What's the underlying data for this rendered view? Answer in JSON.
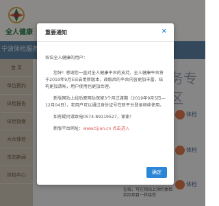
{
  "header": {
    "logo_text": "全人健康"
  },
  "nav": {
    "tab": "宁波体检服务"
  },
  "sidebar": {
    "items": [
      {
        "label": "首 页"
      },
      {
        "label": "单位预约"
      },
      {
        "label": "体检报告"
      },
      {
        "label": "体检指南"
      },
      {
        "label": "大众体检"
      },
      {
        "label": "本站新闻"
      },
      {
        "label": "体检中心"
      }
    ]
  },
  "main": {
    "banner_title": "务专区",
    "cards": [
      {
        "label": "体检"
      },
      {
        "label": "体检"
      },
      {
        "label": "体检"
      }
    ],
    "footer_line1": "在线，可在网站上预约体检",
    "footer_line2": "实际项目一样接受"
  },
  "modal": {
    "title": "重要通知",
    "close_symbol": "×",
    "greeting": "各位全人健康的用户：",
    "para1": "您好！感谢您一直对全人健康平台的支持，全人健康平台将于2019年9月5日启用新版本，改版后的平台内容更加丰富，结构更加清晰，用户使用也更加合理。",
    "para2": "新版网站上线后原网站保留3个月过渡期（2019年9月5日—12月04日），老用户可以通过身份证号在新平台登录继续使用。",
    "para3": "如有疑问请致电0574-89119527，谢谢！",
    "para4_prefix": "新版平台网址：",
    "site_url": "www.tijian.cn",
    "para4_suffix": " 点击进入",
    "ok_label": "确定"
  },
  "colors": {
    "nav_bg": "#5d86a6",
    "sidebar_bg": "#d1c9b9",
    "accent_blue": "#2b86d8",
    "link_red": "#d9534f"
  }
}
